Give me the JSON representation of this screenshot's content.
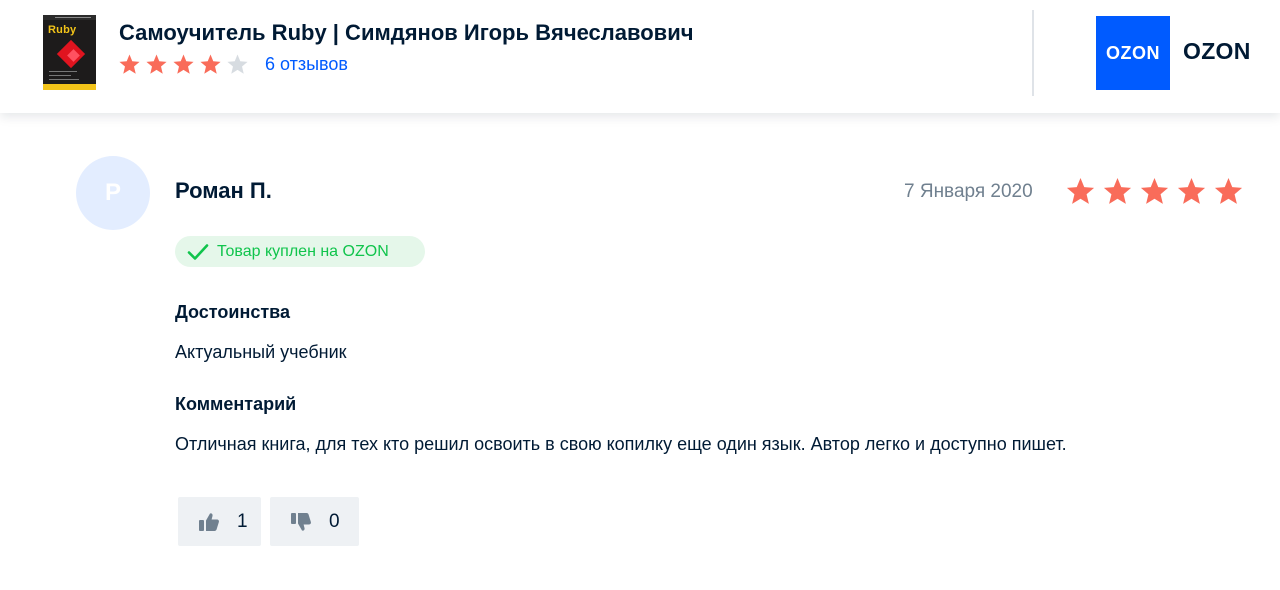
{
  "product": {
    "title": "Самоучитель Ruby | Симдянов Игорь Вячеславович",
    "cover_word": "Ruby",
    "rating": 4,
    "rating_max": 5,
    "reviews_link": "6 отзывов"
  },
  "brand": {
    "logo_text": "OZON",
    "name": "OZON",
    "logo_color": "#005bff"
  },
  "review": {
    "avatar_letter": "Р",
    "author": "Роман П.",
    "date": "7 Января 2020",
    "rating": 5,
    "rating_max": 5,
    "badge": "Товар куплен на OZON",
    "pros_heading": "Достоинства",
    "pros_text": "Актуальный учебник",
    "comment_heading": "Комментарий",
    "comment_text": "Отличная книга, для тех кто решил освоить в свою копилку еще один язык. Автор легко и доступно пишет.",
    "likes": "1",
    "dislikes": "0"
  },
  "colors": {
    "star_filled": "#f96c5a",
    "star_empty": "#d7dce1",
    "link": "#005bff",
    "badge_bg": "#e5f7ea",
    "badge_text": "#10c44c",
    "avatar_bg": "#e3edff"
  },
  "icons": {
    "star": "star-icon",
    "check": "check-icon",
    "like": "thumbs-up-icon",
    "dislike": "thumbs-down-icon"
  }
}
